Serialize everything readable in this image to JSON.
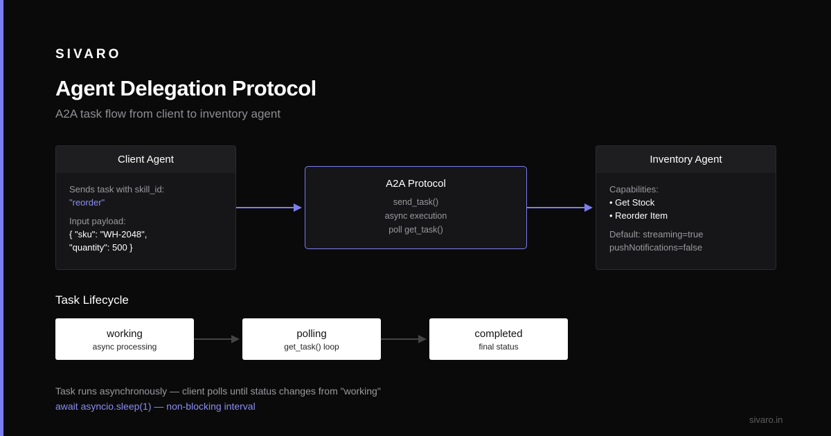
{
  "brand": "SIVARO",
  "title": "Agent Delegation Protocol",
  "subtitle": "A2A task flow from client to inventory agent",
  "client_agent": {
    "header": "Client Agent",
    "line1": "Sends task with skill_id:",
    "skill": "\"reorder\"",
    "payload_label": "Input payload:",
    "payload_line1": "{ \"sku\": \"WH-2048\",",
    "payload_line2": "\"quantity\": 500 }"
  },
  "protocol": {
    "title": "A2A Protocol",
    "lines": [
      "send_task()",
      "async execution",
      "poll get_task()"
    ]
  },
  "inventory_agent": {
    "header": "Inventory Agent",
    "capabilities_label": "Capabilities:",
    "capabilities": [
      "• Get Stock",
      "• Reorder Item"
    ],
    "default_line1": "Default: streaming=true",
    "default_line2": "pushNotifications=false"
  },
  "lifecycle": {
    "label": "Task Lifecycle",
    "states": [
      {
        "name": "working",
        "desc": "async processing"
      },
      {
        "name": "polling",
        "desc": "get_task() loop"
      },
      {
        "name": "completed",
        "desc": "final status"
      }
    ]
  },
  "notes": {
    "line1": "Task runs asynchronously — client polls until status changes from \"working\"",
    "line2": "await asyncio.sleep(1) — non-blocking interval"
  },
  "footer": "sivaro.in",
  "colors": {
    "accent": "#7b7ef0",
    "background": "#0a0a0a",
    "card": "#161618",
    "lifecycle_arrow": "#444444"
  }
}
